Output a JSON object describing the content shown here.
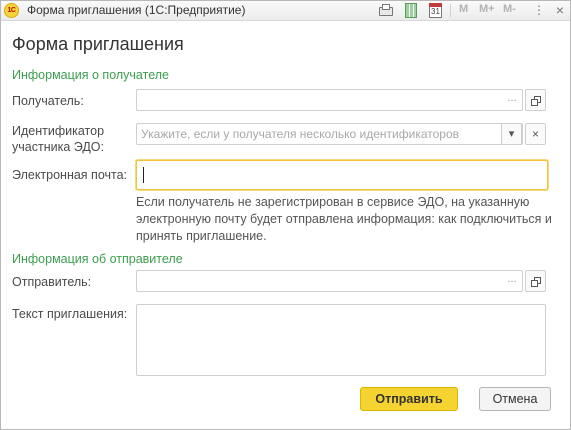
{
  "window": {
    "title": "Форма приглашения  (1С:Предприятие)",
    "logo_text": "1С",
    "calendar_day": "31",
    "memory": {
      "m": "M",
      "m_plus": "M+",
      "m_minus": "M-"
    },
    "more_glyph": "⋮",
    "close_glyph": "×"
  },
  "form": {
    "title": "Форма приглашения",
    "recipient_group": "Информация о получателе",
    "sender_group": "Информация об отправителе"
  },
  "fields": {
    "recipient_label": "Получатель:",
    "recipient_value": "",
    "edo_label_line1": "Идентификатор",
    "edo_label_line2": "участника ЭДО:",
    "edo_placeholder": "Укажите, если у получателя несколько идентификаторов",
    "email_label": "Электронная почта:",
    "email_value": "",
    "email_hint": "Если получатель не зарегистрирован в сервисе ЭДО, на указанную электронную почту будет отправлена информация: как подключиться и принять приглашение.",
    "sender_label": "Отправитель:",
    "sender_value": "",
    "invitation_text_label": "Текст приглашения:",
    "invitation_text_value": "",
    "select_glyph": "...",
    "dropdown_glyph": "▾",
    "clear_glyph": "×"
  },
  "buttons": {
    "send": "Отправить",
    "cancel": "Отмена"
  },
  "colors": {
    "accent_yellow": "#f5d431",
    "group_green": "#3c9e4e",
    "focus_border": "#f3c43b"
  },
  "icons": [
    "app-logo-icon",
    "print-icon",
    "calculator-icon",
    "calendar-icon",
    "more-icon",
    "close-icon",
    "open-icon",
    "dropdown-icon",
    "clear-icon"
  ]
}
